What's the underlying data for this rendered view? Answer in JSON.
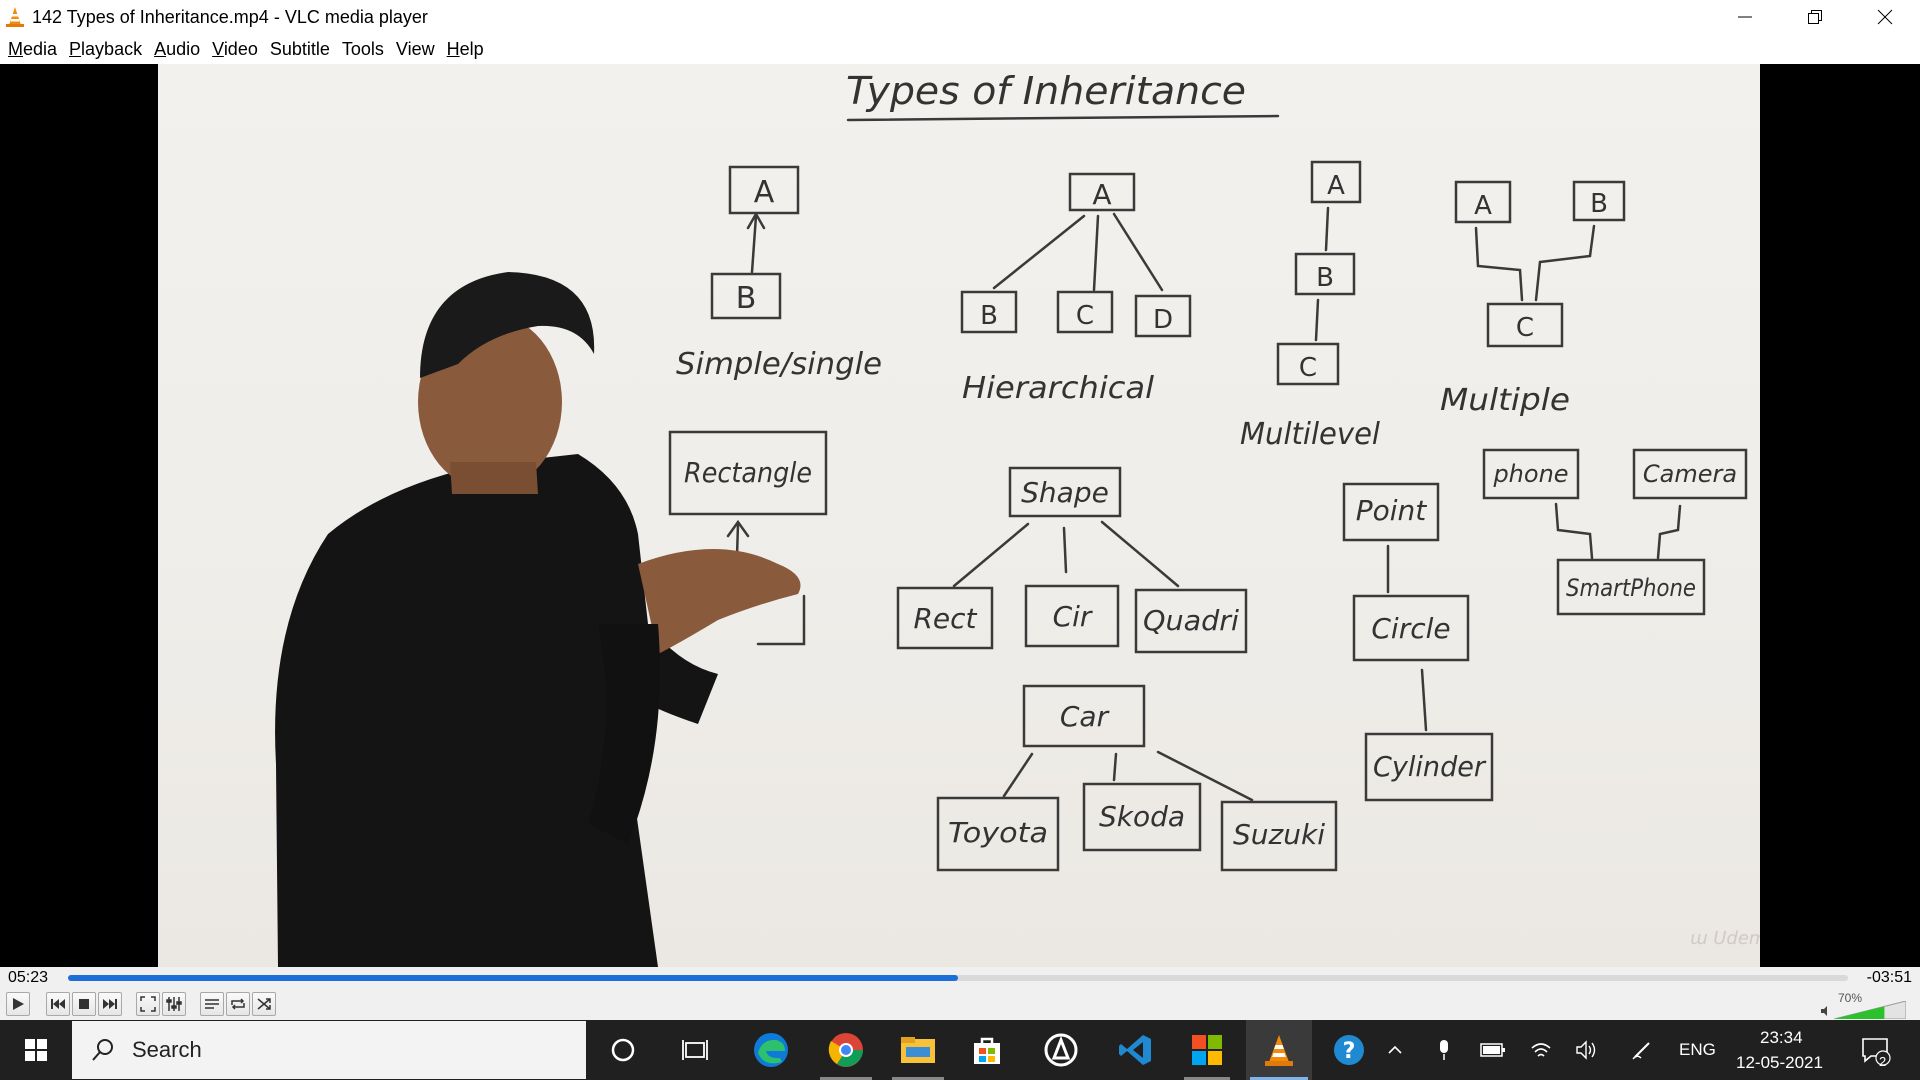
{
  "window": {
    "title": "142 Types of Inheritance.mp4 - VLC media player"
  },
  "menu": [
    {
      "label": "Media",
      "key": "M",
      "rest": "edia"
    },
    {
      "label": "Playback",
      "key": "P",
      "rest": "layback"
    },
    {
      "label": "Audio",
      "key": "A",
      "rest": "udio"
    },
    {
      "label": "Video",
      "key": "V",
      "rest": "ideo"
    },
    {
      "label": "Subtitle",
      "key": "",
      "rest": "Subtitle"
    },
    {
      "label": "Tools",
      "key": "",
      "rest": "Tools"
    },
    {
      "label": "View",
      "key": "",
      "rest": "View"
    },
    {
      "label": "Help",
      "key": "H",
      "rest": "elp"
    }
  ],
  "whiteboard": {
    "heading": "Types of Inheritance",
    "simple": {
      "parent": "A",
      "child": "B",
      "label": "Simple/single"
    },
    "hierarchical": {
      "parent": "A",
      "children": [
        "B",
        "C",
        "D"
      ],
      "label": "Hierarchical"
    },
    "multilevel": {
      "levels": [
        "A",
        "B",
        "C"
      ],
      "label": "Multilevel"
    },
    "multiple": {
      "parents": [
        "A",
        "B"
      ],
      "child": "C",
      "label": "Multiple"
    },
    "rectangle_example": {
      "parent": "Rectangle"
    },
    "shape_example": {
      "parent": "Shape",
      "children": [
        "Rect",
        "Cir",
        "Quadri"
      ]
    },
    "car_example": {
      "parent": "Car",
      "children": [
        "Toyota",
        "Skoda",
        "Suzuki"
      ]
    },
    "point_example": {
      "levels": [
        "Point",
        "Circle",
        "Cylinder"
      ]
    },
    "phone_example": {
      "parents": [
        "phone",
        "Camera"
      ],
      "child": "SmartPhone"
    }
  },
  "player": {
    "elapsed": "05:23",
    "remaining": "-03:51",
    "progress": 0.5,
    "volume": "70%",
    "volume_level": 0.7,
    "accent_color": "#1c6fd6"
  },
  "controls": [
    "play-icon",
    "previous-icon",
    "stop-icon",
    "next-icon",
    "fullscreen-icon",
    "extended-settings-icon",
    "playlist-icon",
    "loop-icon",
    "shuffle-icon"
  ],
  "taskbar": {
    "search_label": "Search",
    "apps": [
      "cortana-icon",
      "task-view-icon",
      "edge-icon",
      "chrome-icon",
      "file-explorer-icon",
      "store-icon",
      "app-icon",
      "vscode-icon",
      "office-icon",
      "vlc-icon",
      "help-icon"
    ],
    "language": "ENG",
    "time": "23:34",
    "date": "12-05-2021",
    "notification_count": "2"
  }
}
